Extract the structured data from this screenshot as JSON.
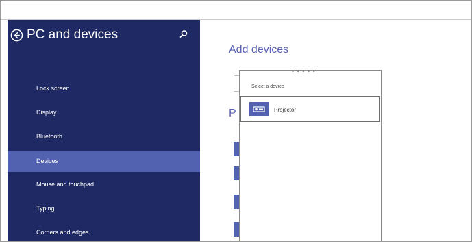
{
  "sidebar": {
    "title": "PC and devices",
    "items": [
      {
        "label": "Lock screen"
      },
      {
        "label": "Display"
      },
      {
        "label": "Bluetooth"
      },
      {
        "label": "Devices"
      },
      {
        "label": "Mouse and touchpad"
      },
      {
        "label": "Typing"
      },
      {
        "label": "Corners and edges"
      }
    ],
    "selected": "Devices"
  },
  "main": {
    "title": "Add devices",
    "partial_heading_letter": "P"
  },
  "flyout": {
    "label": "Select a device",
    "devices": [
      {
        "label": "Projector",
        "icon": "projector-icon"
      }
    ]
  },
  "colors": {
    "sidebar_bg": "#1f2a64",
    "selected_bg": "#5261b0",
    "accent_text": "#5a62b4"
  }
}
